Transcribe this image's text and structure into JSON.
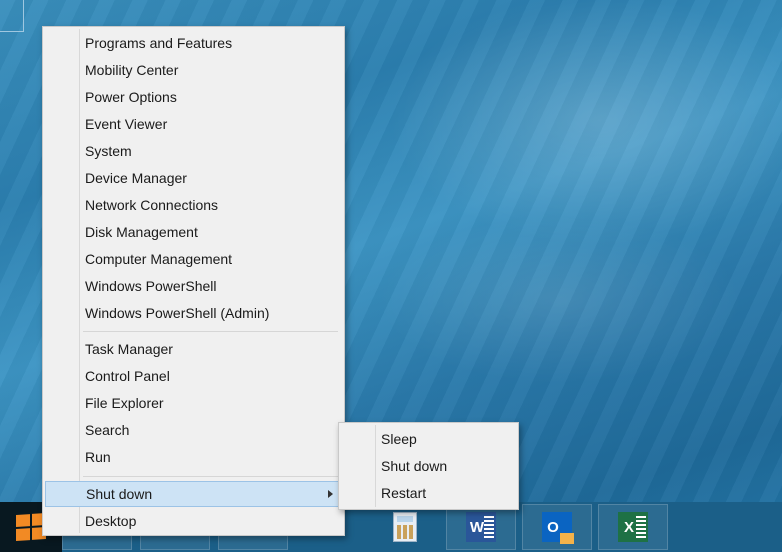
{
  "desktop": {
    "taskbar": {
      "start_button_label": "Start",
      "pinned_apps": [
        {
          "name": "Calculator",
          "icon": "calculator-icon"
        },
        {
          "name": "Word",
          "icon": "word-icon",
          "letter": "W"
        },
        {
          "name": "Outlook",
          "icon": "outlook-icon",
          "letter": "O"
        },
        {
          "name": "Excel",
          "icon": "excel-icon",
          "letter": "X"
        }
      ]
    }
  },
  "context_menu": {
    "group1": [
      "Programs and Features",
      "Mobility Center",
      "Power Options",
      "Event Viewer",
      "System",
      "Device Manager",
      "Network Connections",
      "Disk Management",
      "Computer Management",
      "Windows PowerShell",
      "Windows PowerShell (Admin)"
    ],
    "group2": [
      "Task Manager",
      "Control Panel",
      "File Explorer",
      "Search",
      "Run"
    ],
    "group3": [
      {
        "label": "Shut down",
        "has_submenu": true,
        "highlighted": true
      },
      {
        "label": "Desktop",
        "has_submenu": false,
        "highlighted": false
      }
    ]
  },
  "shutdown_submenu": {
    "items": [
      "Sleep",
      "Shut down",
      "Restart"
    ]
  }
}
